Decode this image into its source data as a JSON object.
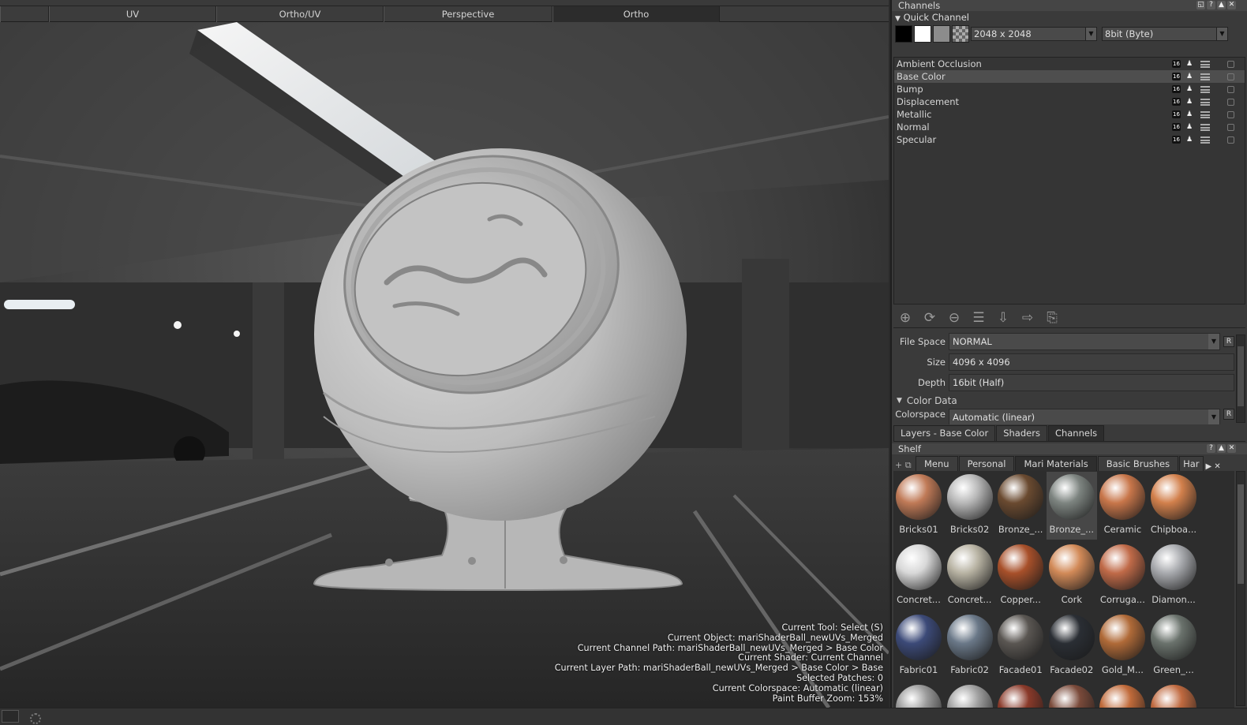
{
  "viewport": {
    "tabs": [
      {
        "label": ""
      },
      {
        "label": "UV"
      },
      {
        "label": "Ortho/UV"
      },
      {
        "label": "Perspective"
      },
      {
        "label": "Ortho"
      }
    ],
    "active_tab": "Ortho",
    "hud": [
      "Current Tool: Select (S)",
      "Current Object: mariShaderBall_newUVs_Merged",
      "Current Channel Path: mariShaderBall_newUVs_Merged > Base Color",
      "Current Shader: Current Channel",
      "Current Layer Path: mariShaderBall_newUVs_Merged > Base Color > Base",
      "Selected Patches: 0",
      "Current Colorspace: Automatic (linear)",
      "Paint Buffer Zoom: 153%"
    ]
  },
  "channels_panel": {
    "title": "Channels",
    "quick_channel_label": "Quick Channel",
    "size_value": "2048 x 2048",
    "depth_value": "8bit  (Byte)",
    "channels": [
      {
        "name": "Ambient Occlusion",
        "badge": "16",
        "selected": false
      },
      {
        "name": "Base Color",
        "badge": "16",
        "selected": true
      },
      {
        "name": "Bump",
        "badge": "16",
        "selected": false
      },
      {
        "name": "Displacement",
        "badge": "16",
        "selected": false
      },
      {
        "name": "Metallic",
        "badge": "16",
        "selected": false
      },
      {
        "name": "Normal",
        "badge": "16",
        "selected": false
      },
      {
        "name": "Specular",
        "badge": "16",
        "selected": false
      }
    ],
    "properties": {
      "file_space_label": "File Space",
      "file_space_value": "NORMAL",
      "size_label": "Size",
      "size_value": "4096 x 4096",
      "depth_label": "Depth",
      "depth_value": "16bit (Half)",
      "color_data_label": "Color Data",
      "colorspace_label": "Colorspace",
      "colorspace_value": "Automatic (linear)",
      "reset_label": "R"
    }
  },
  "palette_tabs": [
    {
      "label": "Layers - Base Color",
      "active": false
    },
    {
      "label": "Shaders",
      "active": false
    },
    {
      "label": "Channels",
      "active": true
    }
  ],
  "shelf": {
    "title": "Shelf",
    "tabs": [
      {
        "label": "Menu",
        "active": false
      },
      {
        "label": "Personal",
        "active": false
      },
      {
        "label": "Mari Materials",
        "active": true
      },
      {
        "label": "Basic Brushes",
        "active": false
      },
      {
        "label": "Har",
        "active": false
      }
    ],
    "materials": [
      {
        "label": "Bricks01",
        "color": "#c07a57"
      },
      {
        "label": "Bricks02",
        "color": "#b8b8b8"
      },
      {
        "label": "Bronze_...",
        "color": "#6a4a30"
      },
      {
        "label": "Bronze_...",
        "color": "#7d8480"
      },
      {
        "label": "Ceramic",
        "color": "#c8764a"
      },
      {
        "label": "Chipboa...",
        "color": "#d2804c"
      },
      {
        "label": "Concret...",
        "color": "#d8d8d8"
      },
      {
        "label": "Concret...",
        "color": "#b8b3a3"
      },
      {
        "label": "Copper...",
        "color": "#a8502a"
      },
      {
        "label": "Cork",
        "color": "#d28a58"
      },
      {
        "label": "Corruga...",
        "color": "#c06a48"
      },
      {
        "label": "Diamon...",
        "color": "#a8aaae"
      },
      {
        "label": "Fabric01",
        "color": "#3c4a78"
      },
      {
        "label": "Fabric02",
        "color": "#6a7888"
      },
      {
        "label": "Facade01",
        "color": "#5a5652"
      },
      {
        "label": "Facade02",
        "color": "#2a2e34"
      },
      {
        "label": "Gold_M...",
        "color": "#b06a38"
      },
      {
        "label": "Green_...",
        "color": "#6a726c"
      },
      {
        "label": "",
        "color": "#9a9a9a"
      },
      {
        "label": "",
        "color": "#a0a0a0"
      },
      {
        "label": "",
        "color": "#8a3a2a"
      },
      {
        "label": "",
        "color": "#7a4a3a"
      },
      {
        "label": "",
        "color": "#c06a3a"
      },
      {
        "label": "",
        "color": "#c06a40"
      }
    ]
  }
}
